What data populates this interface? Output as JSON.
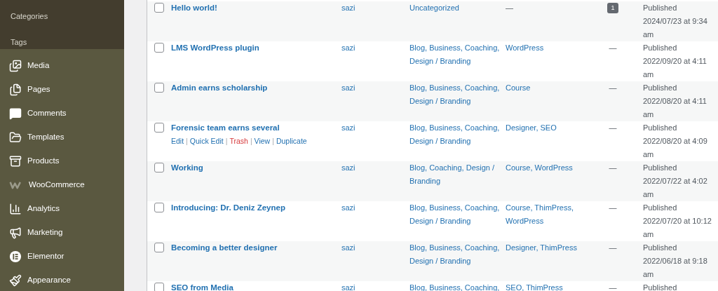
{
  "sidebar": {
    "submenu": [
      {
        "label": "Categories"
      },
      {
        "label": "Tags"
      }
    ],
    "items": [
      {
        "label": "Media"
      },
      {
        "label": "Pages"
      },
      {
        "label": "Comments"
      },
      {
        "label": "Templates"
      },
      {
        "label": "Products"
      },
      {
        "label": "WooCommerce"
      },
      {
        "label": "Analytics"
      },
      {
        "label": "Marketing"
      },
      {
        "label": "Elementor"
      },
      {
        "label": "Appearance"
      }
    ]
  },
  "posts": {
    "rows": [
      {
        "checked": false,
        "title": "Hello world!",
        "author": "sazi",
        "categories": "Uncategorized",
        "tags": "—",
        "comments": {
          "kind": "count",
          "text": "1"
        },
        "date": [
          "Published",
          "2024/07/23 at 9:34",
          "am"
        ]
      },
      {
        "checked": false,
        "title": "LMS WordPress plugin",
        "author": "sazi",
        "categories": "Blog, Business, Coaching, Design / Branding",
        "tags": "WordPress",
        "comments": {
          "kind": "none",
          "text": "—"
        },
        "date": [
          "Published",
          "2022/09/20 at 4:11",
          "am"
        ]
      },
      {
        "checked": false,
        "title": "Admin earns scholarship",
        "author": "sazi",
        "categories": "Blog, Business, Coaching, Design / Branding",
        "tags": "Course",
        "comments": {
          "kind": "none",
          "text": "—"
        },
        "date": [
          "Published",
          "2022/08/20 at 4:11",
          "am"
        ]
      },
      {
        "checked": false,
        "title": "Forensic team earns several",
        "author": "sazi",
        "categories": "Blog, Business, Coaching, Design / Branding",
        "tags": "Designer, SEO",
        "comments": {
          "kind": "none",
          "text": "—"
        },
        "date": [
          "Published",
          "2022/08/20 at 4:09",
          "am"
        ],
        "actions": [
          {
            "label": "Edit",
            "kind": "link"
          },
          {
            "label": "Quick Edit",
            "kind": "link"
          },
          {
            "label": "Trash",
            "kind": "delete"
          },
          {
            "label": "View",
            "kind": "link"
          },
          {
            "label": "Duplicate",
            "kind": "link"
          }
        ],
        "separators": [
          "|",
          "|",
          "|",
          "|"
        ]
      },
      {
        "checked": false,
        "title": "Working",
        "author": "sazi",
        "categories": "Blog, Coaching, Design / Branding",
        "tags": "Course, WordPress",
        "comments": {
          "kind": "none",
          "text": "—"
        },
        "date": [
          "Published",
          "2022/07/22 at 4:02",
          "am"
        ]
      },
      {
        "checked": false,
        "title": "Introducing: Dr. Deniz Zeynep",
        "author": "sazi",
        "categories": "Blog, Business, Coaching, Design / Branding",
        "tags": "Course, ThimPress, WordPress",
        "comments": {
          "kind": "none",
          "text": "—"
        },
        "date": [
          "Published",
          "2022/07/20 at 10:12",
          "am"
        ]
      },
      {
        "checked": false,
        "title": "Becoming a better designer",
        "author": "sazi",
        "categories": "Blog, Business, Coaching, Design / Branding",
        "tags": "Designer, ThimPress",
        "comments": {
          "kind": "none",
          "text": "—"
        },
        "date": [
          "Published",
          "2022/06/18 at 9:18",
          "am"
        ]
      },
      {
        "checked": false,
        "title": "SEO from Media",
        "author": "sazi",
        "categories": "Blog, Business, Coaching,",
        "tags": "SEO, ThimPress",
        "comments": {
          "kind": "none",
          "text": "—"
        },
        "date": [
          "Published"
        ]
      }
    ]
  }
}
